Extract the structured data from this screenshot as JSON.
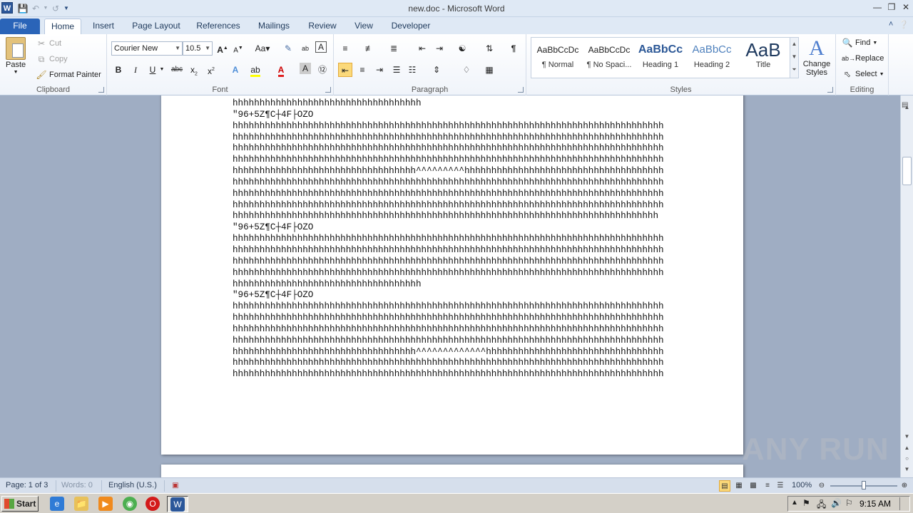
{
  "window": {
    "title": "new.doc - Microsoft Word",
    "app_icon_letter": "W"
  },
  "ribbon_tabs": [
    "File",
    "Home",
    "Insert",
    "Page Layout",
    "References",
    "Mailings",
    "Review",
    "View",
    "Developer"
  ],
  "clipboard": {
    "paste": "Paste",
    "cut": "Cut",
    "copy": "Copy",
    "format_painter": "Format Painter",
    "label": "Clipboard"
  },
  "font": {
    "family": "Courier New",
    "size": "10.5",
    "label": "Font"
  },
  "paragraph": {
    "label": "Paragraph"
  },
  "styles": {
    "label": "Styles",
    "items": [
      {
        "sample": "AaBbCcDc",
        "name": "¶ Normal"
      },
      {
        "sample": "AaBbCcDc",
        "name": "¶ No Spaci..."
      },
      {
        "sample": "AaBbCc",
        "name": "Heading 1"
      },
      {
        "sample": "AaBbCc",
        "name": "Heading 2"
      },
      {
        "sample": "AaB",
        "name": "Title"
      }
    ],
    "change_styles": "Change Styles"
  },
  "editing": {
    "find": "Find",
    "replace": "Replace",
    "select": "Select",
    "label": "Editing"
  },
  "document": {
    "lines": [
      "hhhhhhhhhhhhhhhhhhhhhhhhhhhhhhhhhhh",
      "\"96+5Z¶C┼4F├OZO",
      "hhhhhhhhhhhhhhhhhhhhhhhhhhhhhhhhhhhhhhhhhhhhhhhhhhhhhhhhhhhhhhhhhhhhhhhhhhhhhhhh",
      "hhhhhhhhhhhhhhhhhhhhhhhhhhhhhhhhhhhhhhhhhhhhhhhhhhhhhhhhhhhhhhhhhhhhhhhhhhhhhhhh",
      "hhhhhhhhhhhhhhhhhhhhhhhhhhhhhhhhhhhhhhhhhhhhhhhhhhhhhhhhhhhhhhhhhhhhhhhhhhhhhhhh",
      "hhhhhhhhhhhhhhhhhhhhhhhhhhhhhhhhhhhhhhhhhhhhhhhhhhhhhhhhhhhhhhhhhhhhhhhhhhhhhhhh",
      "hhhhhhhhhhhhhhhhhhhhhhhhhhhhhhhhhh^^^^^^^^^hhhhhhhhhhhhhhhhhhhhhhhhhhhhhhhhhhhhh",
      "hhhhhhhhhhhhhhhhhhhhhhhhhhhhhhhhhhhhhhhhhhhhhhhhhhhhhhhhhhhhhhhhhhhhhhhhhhhhhhhh",
      "hhhhhhhhhhhhhhhhhhhhhhhhhhhhhhhhhhhhhhhhhhhhhhhhhhhhhhhhhhhhhhhhhhhhhhhhhhhhhhhh",
      "hhhhhhhhhhhhhhhhhhhhhhhhhhhhhhhhhhhhhhhhhhhhhhhhhhhhhhhhhhhhhhhhhhhhhhhhhhhhhhhh",
      "hhhhhhhhhhhhhhhhhhhhhhhhhhhhhhhhhhhhhhhhhhhhhhhhhhhhhhhhhhhhhhhhhhhhhhhhhhhhhhh",
      "\"96+5Z¶C┼4F├OZO",
      "hhhhhhhhhhhhhhhhhhhhhhhhhhhhhhhhhhhhhhhhhhhhhhhhhhhhhhhhhhhhhhhhhhhhhhhhhhhhhhhh",
      "hhhhhhhhhhhhhhhhhhhhhhhhhhhhhhhhhhhhhhhhhhhhhhhhhhhhhhhhhhhhhhhhhhhhhhhhhhhhhhhh",
      "hhhhhhhhhhhhhhhhhhhhhhhhhhhhhhhhhhhhhhhhhhhhhhhhhhhhhhhhhhhhhhhhhhhhhhhhhhhhhhhh",
      "hhhhhhhhhhhhhhhhhhhhhhhhhhhhhhhhhhhhhhhhhhhhhhhhhhhhhhhhhhhhhhhhhhhhhhhhhhhhhhhh",
      "hhhhhhhhhhhhhhhhhhhhhhhhhhhhhhhhhhh",
      "\"96+5Z¶C┼4F├OZO",
      "hhhhhhhhhhhhhhhhhhhhhhhhhhhhhhhhhhhhhhhhhhhhhhhhhhhhhhhhhhhhhhhhhhhhhhhhhhhhhhhh",
      "hhhhhhhhhhhhhhhhhhhhhhhhhhhhhhhhhhhhhhhhhhhhhhhhhhhhhhhhhhhhhhhhhhhhhhhhhhhhhhhh",
      "hhhhhhhhhhhhhhhhhhhhhhhhhhhhhhhhhhhhhhhhhhhhhhhhhhhhhhhhhhhhhhhhhhhhhhhhhhhhhhhh",
      "hhhhhhhhhhhhhhhhhhhhhhhhhhhhhhhhhhhhhhhhhhhhhhhhhhhhhhhhhhhhhhhhhhhhhhhhhhhhhhhh",
      "hhhhhhhhhhhhhhhhhhhhhhhhhhhhhhhhhh^^^^^^^^^^^^^hhhhhhhhhhhhhhhhhhhhhhhhhhhhhhhhh",
      "hhhhhhhhhhhhhhhhhhhhhhhhhhhhhhhhhhhhhhhhhhhhhhhhhhhhhhhhhhhhhhhhhhhhhhhhhhhhhhhh",
      "hhhhhhhhhhhhhhhhhhhhhhhhhhhhhhhhhhhhhhhhhhhhhhhhhhhhhhhhhhhhhhhhhhhhhhhhhhhhhhhh"
    ]
  },
  "status": {
    "page": "Page: 1 of 3",
    "words": "Words: 0",
    "language": "English (U.S.)",
    "zoom": "100%",
    "zoom_fraction": 0.5
  },
  "watermark": "ANY RUN",
  "taskbar": {
    "start": "Start",
    "clock": "9:15 AM"
  },
  "colors": {
    "file_tab": "#2a64b8",
    "word_blue": "#2b579a",
    "highlight": "#fbd97a"
  }
}
